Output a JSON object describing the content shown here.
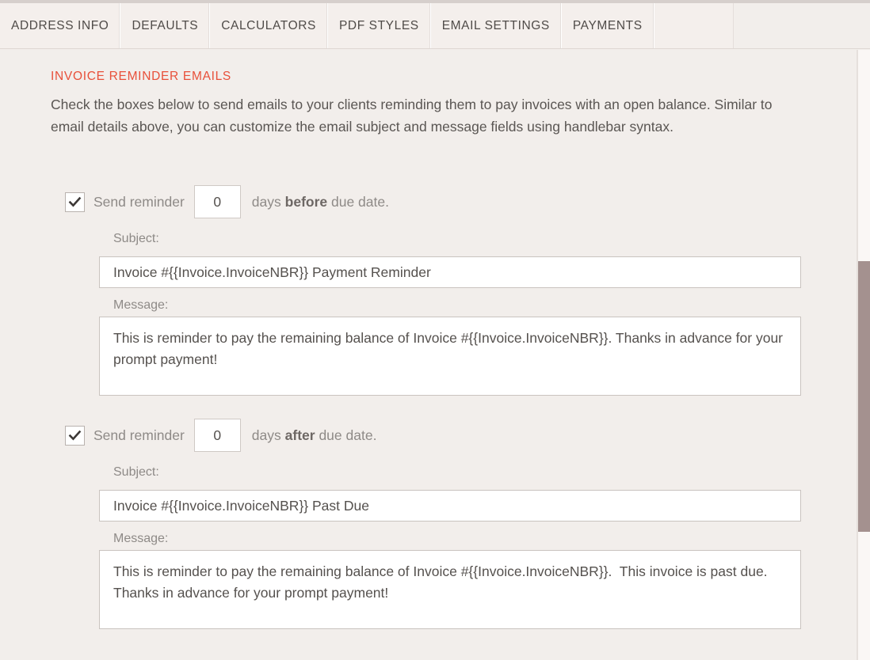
{
  "tabs": [
    {
      "label": "ADDRESS INFO"
    },
    {
      "label": "DEFAULTS"
    },
    {
      "label": "CALCULATORS"
    },
    {
      "label": "PDF STYLES"
    },
    {
      "label": "EMAIL SETTINGS"
    },
    {
      "label": "PAYMENTS"
    }
  ],
  "section": {
    "title": "INVOICE REMINDER EMAILS",
    "description": "Check the boxes below to send emails to your clients reminding them to pay invoices with an open balance. Similar to email details above, you can customize the email subject and message fields using handlebar syntax."
  },
  "reminders": [
    {
      "checked": true,
      "check_icon": "checkmark-icon",
      "label_prefix": "Send reminder",
      "days": "0",
      "label_days": "days",
      "timing": "before",
      "label_suffix": "due date.",
      "subject_label": "Subject:",
      "subject_value": "Invoice #{{Invoice.InvoiceNBR}} Payment Reminder",
      "message_label": "Message:",
      "message_value": "This is reminder to pay the remaining balance of Invoice #{{Invoice.InvoiceNBR}}. Thanks in advance for your prompt payment!"
    },
    {
      "checked": true,
      "check_icon": "checkmark-icon",
      "label_prefix": "Send reminder",
      "days": "0",
      "label_days": "days",
      "timing": "after",
      "label_suffix": "due date.",
      "subject_label": "Subject:",
      "subject_value": "Invoice #{{Invoice.InvoiceNBR}} Past Due",
      "message_label": "Message:",
      "message_value": "This is reminder to pay the remaining balance of Invoice #{{Invoice.InvoiceNBR}}.  This invoice is past due.  Thanks in advance for your prompt payment!"
    }
  ],
  "colors": {
    "accent": "#e8503a",
    "page_background": "#f2eeeb",
    "tab_background": "#f4efec",
    "scrollbar_thumb": "#a4918f",
    "text": "#55514e",
    "muted_text": "#8e8a87"
  }
}
